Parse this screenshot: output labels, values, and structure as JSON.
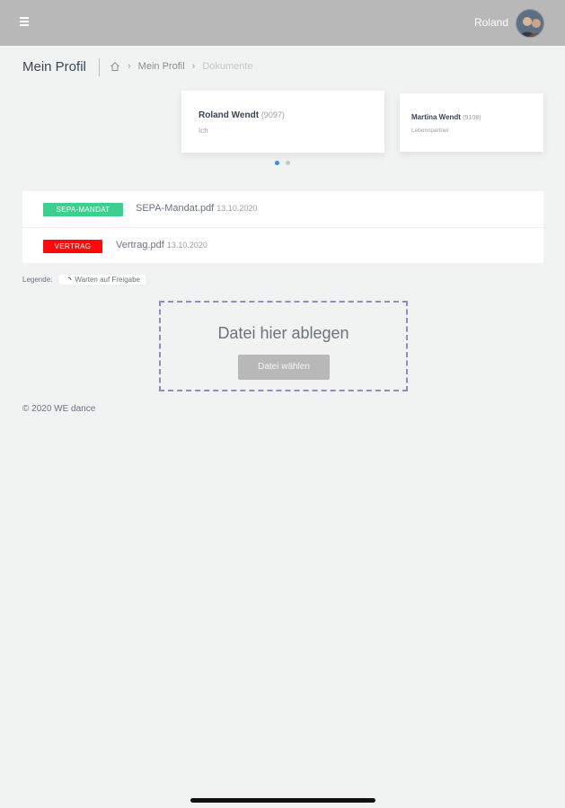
{
  "header": {
    "menu_icon": "hamburger-icon",
    "user_name": "Roland"
  },
  "page": {
    "title": "Mein Profil",
    "breadcrumb": {
      "home_icon": "home-icon",
      "items": [
        "Mein Profil",
        "Dokumente"
      ]
    }
  },
  "members": [
    {
      "name": "Roland Wendt",
      "id": "(9097)",
      "relation": "Ich",
      "active": true
    },
    {
      "name": "Martina Wendt",
      "id": "(9108)",
      "relation": "Lebenspartner",
      "active": false
    }
  ],
  "carousel": {
    "active_index": 0,
    "count": 2,
    "active_color": "#3a8ee6"
  },
  "documents": [
    {
      "badge": "SEPA-MANDAT",
      "badge_color": "#3ccf8e",
      "file": "SEPA-Mandat.pdf",
      "date": "13.10.2020"
    },
    {
      "badge": "VERTRAG",
      "badge_color": "#ff0a0a",
      "file": "Vertrag.pdf",
      "date": "13.10.2020"
    }
  ],
  "legend": {
    "label": "Legende:",
    "icon": "spinner-icon",
    "item": "Warten auf Freigabe"
  },
  "upload": {
    "drop_label": "Datei hier ablegen",
    "button_label": "Datei wählen"
  },
  "footer": {
    "copyright": "© 2020 WE dance"
  }
}
